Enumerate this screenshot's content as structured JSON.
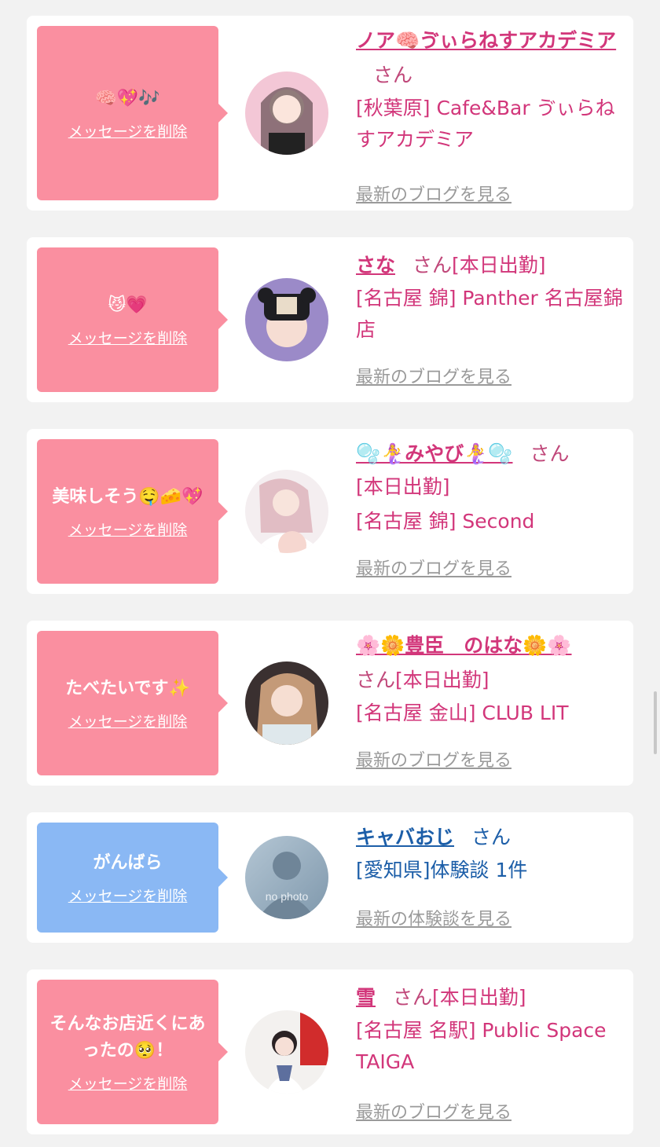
{
  "delete_label": "メッセージを削除",
  "san_label": "さん",
  "colors": {
    "pink": "#fa8fa0",
    "blue": "#8ab8f4",
    "name_pink": "#d2367a",
    "name_blue": "#1c5ea8",
    "link_gray": "#9a9a9a"
  },
  "cards": [
    {
      "message": "🧠💖🎶",
      "name": "ノア🧠ゔぃらねすアカデミア",
      "status": "",
      "shop": "[秋葉原] Cafe&Bar ゔぃらねすアカデミア",
      "link": "最新のブログを見る"
    },
    {
      "message": "😼💗",
      "name": "さな",
      "status": "[本日出勤]",
      "shop": "[名古屋 錦] Panther 名古屋錦店",
      "link": "最新のブログを見る"
    },
    {
      "message": "美味しそう🤤🧀💖",
      "name": "🫧🧜‍♀️みやび🧜‍♀️🫧",
      "status": "[本日出勤]",
      "shop": "[名古屋 錦] Second",
      "link": "最新のブログを見る"
    },
    {
      "message": "たべたいです✨",
      "name": "🌸🌼豊臣　のはな🌼🌸",
      "status": "[本日出勤]",
      "shop": "[名古屋 金山] CLUB LIT",
      "link": "最新のブログを見る"
    },
    {
      "message": "がんばら",
      "name": "キャバおじ",
      "status": "",
      "shop": "[愛知県]体験談 1件",
      "link": "最新の体験談を見る",
      "avatar_text": "no photo"
    },
    {
      "message": "そんなお店近くにあったの🥺！",
      "name": "雪",
      "status": "[本日出勤]",
      "shop": "[名古屋 名駅] Public Space TAIGA",
      "link": "最新のブログを見る"
    }
  ]
}
